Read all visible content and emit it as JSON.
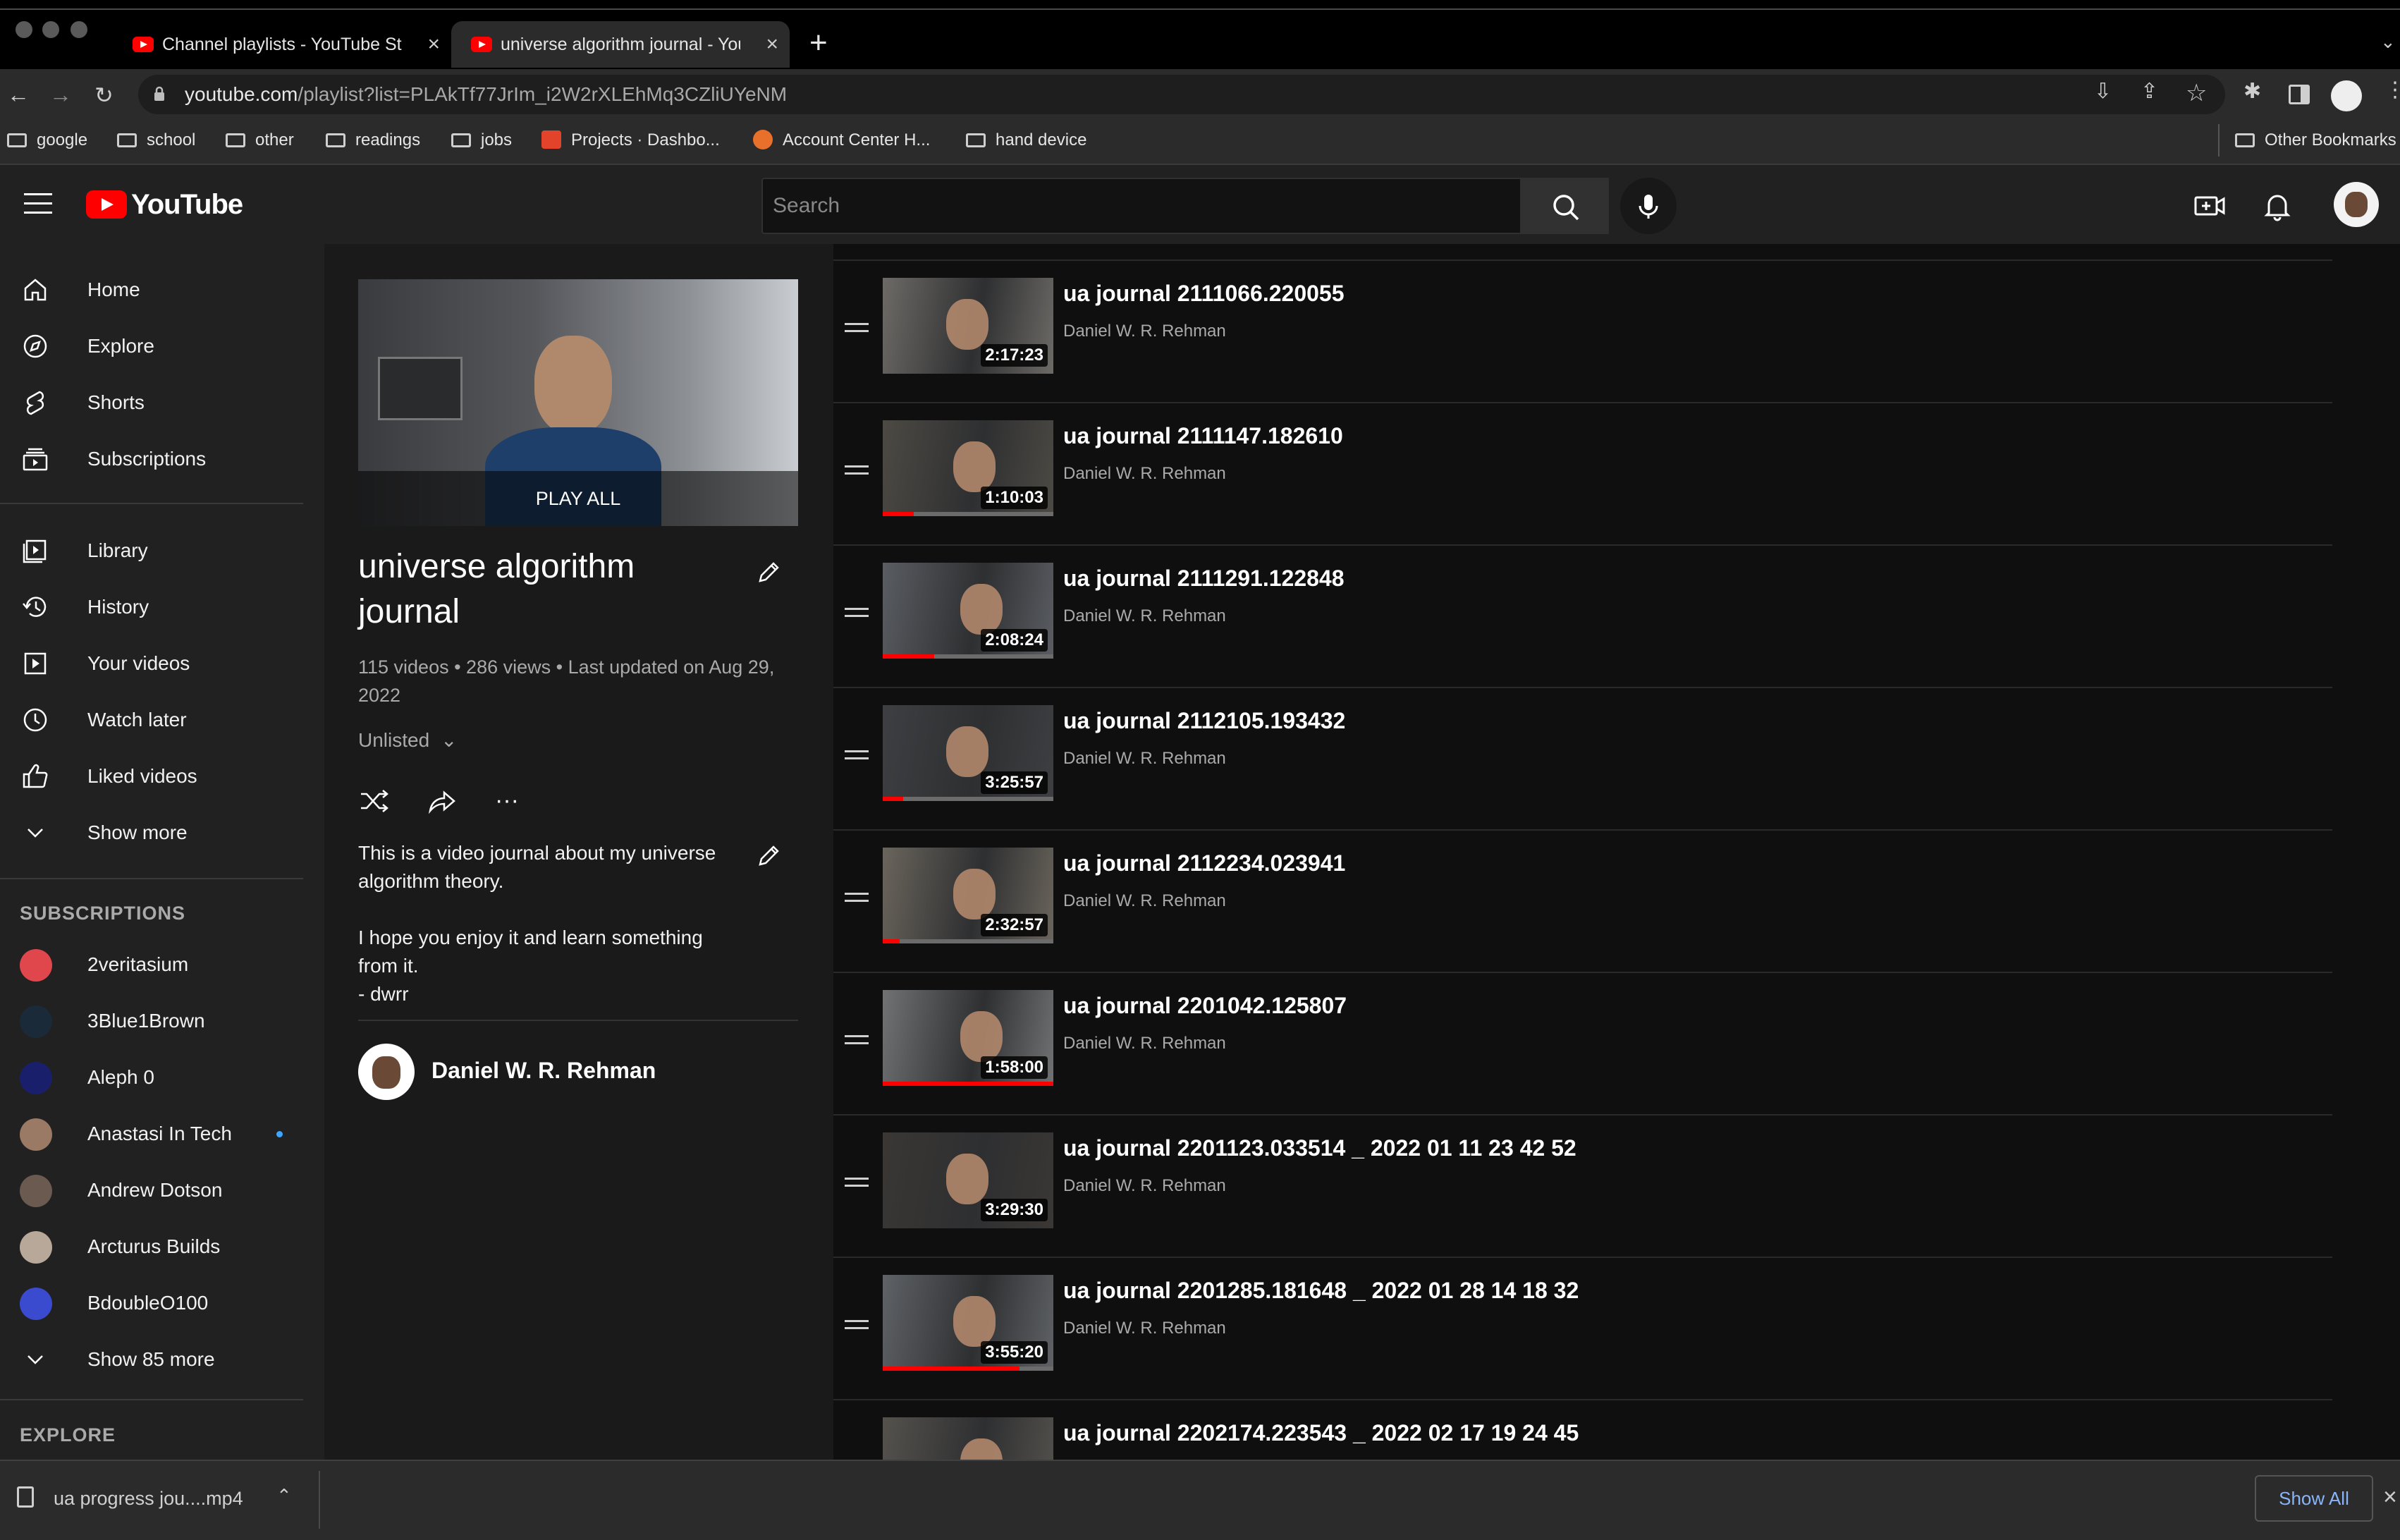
{
  "browser": {
    "tabs": [
      {
        "title": "Channel playlists - YouTube Studio",
        "active": false
      },
      {
        "title": "universe algorithm journal - YouTube",
        "active": true
      }
    ],
    "new_tab_label": "+",
    "url_host": "youtube.com",
    "url_path": "/playlist?list=PLAkTf77JrIm_i2W2rXLEhMq3CZliUYeNM",
    "bookmarks": [
      "google",
      "school",
      "other",
      "readings",
      "jobs",
      "Projects · Dashbo...",
      "Account Center H...",
      "hand device"
    ],
    "other_bookmarks": "Other Bookmarks"
  },
  "header": {
    "logo_text": "YouTube",
    "search_placeholder": "Search"
  },
  "sidebar": {
    "primary": [
      "Home",
      "Explore",
      "Shorts",
      "Subscriptions"
    ],
    "library": [
      "Library",
      "History",
      "Your videos",
      "Watch later",
      "Liked videos",
      "Show more"
    ],
    "subscriptions_heading": "SUBSCRIPTIONS",
    "subscriptions": [
      {
        "name": "2veritasium",
        "color": "#e0474c",
        "new": false
      },
      {
        "name": "3Blue1Brown",
        "color": "#1b2a38",
        "new": false
      },
      {
        "name": "Aleph 0",
        "color": "#1a1f6b",
        "new": false
      },
      {
        "name": "Anastasi In Tech",
        "color": "#9a7a64",
        "new": true
      },
      {
        "name": "Andrew Dotson",
        "color": "#6a5a50",
        "new": false
      },
      {
        "name": "Arcturus Builds",
        "color": "#b8a89a",
        "new": false
      },
      {
        "name": "BdoubleO100",
        "color": "#3a4bd0",
        "new": false
      }
    ],
    "show_more_subs": "Show 85 more",
    "explore_heading": "EXPLORE"
  },
  "playlist": {
    "play_all": "PLAY ALL",
    "title": "universe algorithm journal",
    "meta": "115 videos • 286 views • Last updated on Aug 29, 2022",
    "privacy": "Unlisted",
    "description": "This is a video journal about my universe algorithm theory.\n\nI hope you enjoy it and learn something from it.\n - dwrr",
    "owner": "Daniel W. R. Rehman"
  },
  "videos": [
    {
      "title": "ua journal 2111066.220055",
      "channel": "Daniel W. R. Rehman",
      "duration": "2:17:23",
      "watched": 0,
      "tone": "#6d6a66"
    },
    {
      "title": "ua journal 2111147.182610",
      "channel": "Daniel W. R. Rehman",
      "duration": "1:10:03",
      "watched": 0.18,
      "tone": "#4d4a44"
    },
    {
      "title": "ua journal 2111291.122848",
      "channel": "Daniel W. R. Rehman",
      "duration": "2:08:24",
      "watched": 0.3,
      "tone": "#5a5d62"
    },
    {
      "title": "ua journal 2112105.193432",
      "channel": "Daniel W. R. Rehman",
      "duration": "3:25:57",
      "watched": 0.12,
      "tone": "#3d3f42"
    },
    {
      "title": "ua journal 2112234.023941",
      "channel": "Daniel W. R. Rehman",
      "duration": "2:32:57",
      "watched": 0.1,
      "tone": "#6a655c"
    },
    {
      "title": "ua journal 2201042.125807",
      "channel": "Daniel W. R. Rehman",
      "duration": "1:58:00",
      "watched": 1.0,
      "tone": "#707274"
    },
    {
      "title": "ua journal 2201123.033514 _ 2022 01 11 23 42 52",
      "channel": "Daniel W. R. Rehman",
      "duration": "3:29:30",
      "watched": 0,
      "tone": "#3a3734"
    },
    {
      "title": "ua journal 2201285.181648 _ 2022 01 28 14 18 32",
      "channel": "Daniel W. R. Rehman",
      "duration": "3:55:20",
      "watched": 0.8,
      "tone": "#5f6266"
    },
    {
      "title": "ua journal 2202174.223543 _ 2022 02 17 19 24 45",
      "channel": "Daniel W. R. Rehman",
      "duration": "",
      "watched": 0,
      "tone": "#55524d"
    }
  ],
  "download": {
    "file": "ua progress jou....mp4",
    "show_all": "Show All"
  }
}
